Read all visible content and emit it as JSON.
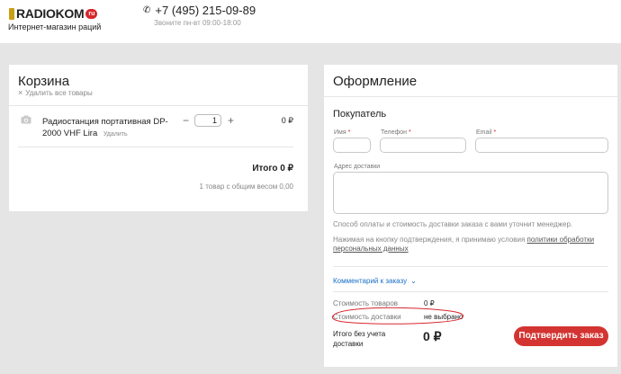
{
  "header": {
    "logo_text": "RADIOKOM",
    "logo_badge": "ru",
    "logo_subtitle": "Интернет-магазин раций",
    "phone": "+7 (495) 215-09-89",
    "hours": "Звоните пн-вт 09:00-18:00"
  },
  "cart": {
    "title": "Корзина",
    "clear_label": "Удалить все товары",
    "items": [
      {
        "name": "Радиостанция портативная DP-2000 VHF Lira",
        "remove_label": "Удалить",
        "quantity": "1",
        "price": "0 ₽"
      }
    ],
    "total_label": "Итого 0 ₽",
    "summary": "1 товар с общим весом 0,00"
  },
  "checkout": {
    "title": "Оформление",
    "buyer_heading": "Покупатель",
    "fields": {
      "name": "Имя",
      "phone": "Телефон",
      "email": "Email",
      "address": "Адрес доставки"
    },
    "required_mark": "*",
    "note1": "Способ оплаты и стоимость доставки заказа с вами уточнит менеджер.",
    "note2_prefix": "Нажимая на кнопку подтверждения, я принимаю условия",
    "note2_link": "политики обработки персональных данных",
    "comment_toggle": "Комментарий к заказу",
    "goods_label": "Стоимость товаров",
    "goods_value": "0 ₽",
    "shipping_label": "Стоимость доставки",
    "shipping_value": "не выбрано",
    "total_ex_label": "Итого без учета доставки",
    "total_ex_value": "0 ₽",
    "confirm_label": "Подтвердить заказ"
  },
  "colors": {
    "accent_red": "#d33431",
    "link_blue": "#1a6fc4",
    "annotation_red": "#d7262b",
    "page_bg": "#e5e5e5"
  }
}
